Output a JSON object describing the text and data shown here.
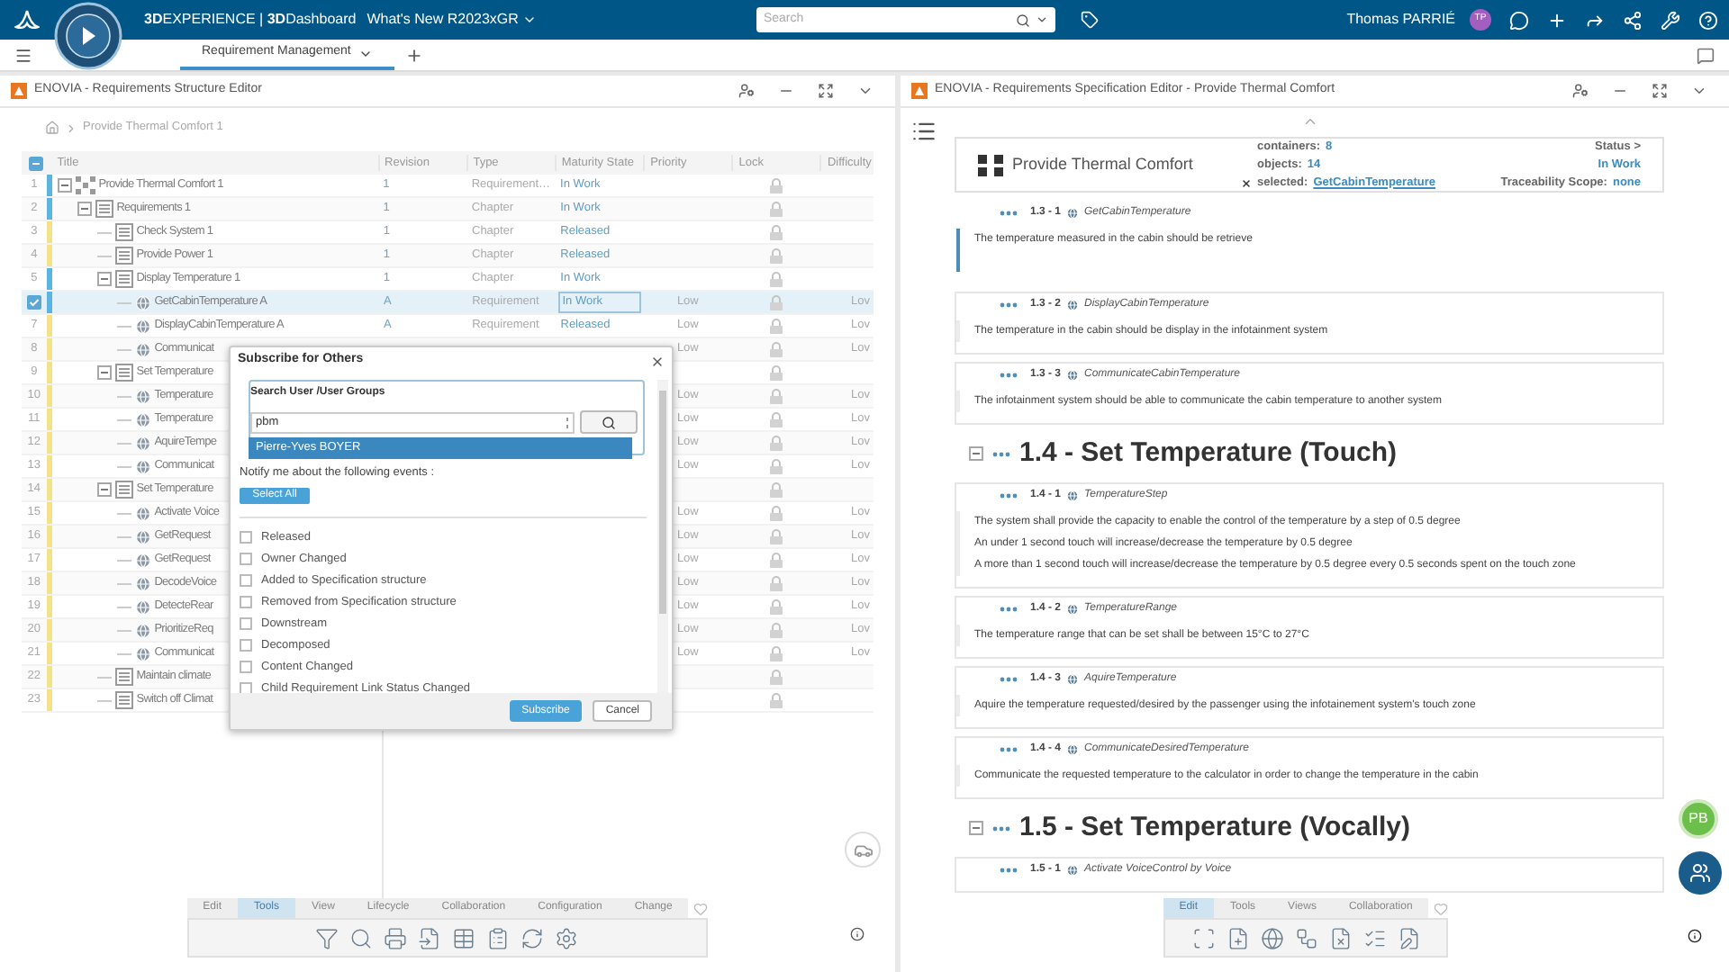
{
  "top_bar": {
    "brand": "**3D**EXPERIENCE | **3D**Dashboard",
    "dashboard": "What's New R2023xGR",
    "search": {
      "placeholder": "Search"
    },
    "user": {
      "name": "Thomas PARRIÉ",
      "initials": "TP"
    }
  },
  "tabs": [
    {
      "label": "Requirement Management",
      "selected": true
    }
  ],
  "structure_editor": {
    "title": "ENOVIA - Requirements Structure Editor",
    "breadcrumb": [
      "Provide Thermal Comfort 1"
    ],
    "select_all": {
      "checked": true,
      "indeterminate": true
    },
    "columns": [
      "Title",
      "Revision",
      "Type",
      "Maturity State",
      "Priority",
      "Lock",
      "Difficulty"
    ],
    "rows": [
      {
        "number": "1",
        "title": "Provide Thermal Comfort 1",
        "kind": "root",
        "revision": "1",
        "type": "Requirement…",
        "maturity": "In Work",
        "color": "#5bb5e0",
        "selected": false,
        "expanded": true,
        "children": [
          {
            "number": "2",
            "title": "Requirements 1",
            "kind": "chapter",
            "revision": "1",
            "type": "Chapter",
            "maturity": "In Work",
            "color": "#5bb5e0",
            "selected": false,
            "expanded": true,
            "children": [
              {
                "number": "3",
                "title": "Check System 1",
                "kind": "chapter",
                "revision": "1",
                "type": "Chapter",
                "maturity": "Released",
                "color": "#f3e28a",
                "selected": false
              },
              {
                "number": "4",
                "title": "Provide Power 1",
                "kind": "chapter",
                "revision": "1",
                "type": "Chapter",
                "maturity": "Released",
                "color": "#f3e28a",
                "selected": false
              },
              {
                "number": "5",
                "title": "Display Temperature 1",
                "kind": "chapter",
                "revision": "1",
                "type": "Chapter",
                "maturity": "In Work",
                "color": "#5bb5e0",
                "selected": false,
                "expanded": true,
                "children": [
                  {
                    "title": "GetCabinTemperature A",
                    "kind": "requirement",
                    "revision": "A",
                    "type": "Requirement",
                    "maturity": "In Work",
                    "priority": "Low",
                    "difficulty": "Lov",
                    "color": "#5bb5e0",
                    "selected": true
                  },
                  {
                    "number": "7",
                    "title": "DisplayCabinTemperature A",
                    "kind": "requirement",
                    "revision": "A",
                    "type": "Requirement",
                    "maturity": "Released",
                    "priority": "Low",
                    "difficulty": "Lov",
                    "color": "#f3e28a",
                    "selected": false
                  },
                  {
                    "number": "8",
                    "title": "Communicat",
                    "kind": "requirement",
                    "priority": "Low",
                    "difficulty": "Lov",
                    "color": "#f3e28a",
                    "selected": false
                  }
                ]
              },
              {
                "number": "9",
                "title": "Set Temperature",
                "kind": "chapter",
                "color": "#f3e28a",
                "selected": false,
                "expanded": true,
                "children": [
                  {
                    "number": "10",
                    "title": "Temperature",
                    "kind": "requirement",
                    "priority": "Low",
                    "difficulty": "Lov",
                    "color": "#f3e28a",
                    "selected": false
                  },
                  {
                    "number": "11",
                    "title": "Temperature",
                    "kind": "requirement",
                    "priority": "Low",
                    "difficulty": "Lov",
                    "color": "#f3e28a",
                    "selected": false
                  },
                  {
                    "number": "12",
                    "title": "AquireTempe",
                    "kind": "requirement",
                    "priority": "Low",
                    "difficulty": "Lov",
                    "color": "#f3e28a",
                    "selected": false
                  },
                  {
                    "number": "13",
                    "title": "Communicat",
                    "kind": "requirement",
                    "priority": "Low",
                    "difficulty": "Lov",
                    "color": "#f3e28a",
                    "selected": false
                  }
                ]
              },
              {
                "number": "14",
                "title": "Set Temperature",
                "kind": "chapter",
                "color": "#f3e28a",
                "selected": false,
                "expanded": true,
                "children": [
                  {
                    "number": "15",
                    "title": "Activate Voice",
                    "kind": "requirement",
                    "priority": "Low",
                    "difficulty": "Lov",
                    "color": "#f3e28a",
                    "selected": false
                  },
                  {
                    "number": "16",
                    "title": "GetRequest",
                    "kind": "requirement",
                    "priority": "Low",
                    "difficulty": "Lov",
                    "color": "#f3e28a",
                    "selected": false
                  },
                  {
                    "number": "17",
                    "title": "GetRequest",
                    "kind": "requirement",
                    "priority": "Low",
                    "difficulty": "Lov",
                    "color": "#f3e28a",
                    "selected": false
                  },
                  {
                    "number": "18",
                    "title": "DecodeVoice",
                    "kind": "requirement",
                    "priority": "Low",
                    "difficulty": "Lov",
                    "color": "#f3e28a",
                    "selected": false
                  },
                  {
                    "number": "19",
                    "title": "DetecteRear",
                    "kind": "requirement",
                    "priority": "Low",
                    "difficulty": "Lov",
                    "color": "#f3e28a",
                    "selected": false
                  },
                  {
                    "number": "20",
                    "title": "PrioritizeReq",
                    "kind": "requirement",
                    "priority": "Low",
                    "difficulty": "Lov",
                    "color": "#f3e28a",
                    "selected": false
                  },
                  {
                    "number": "21",
                    "title": "Communicat",
                    "kind": "requirement",
                    "priority": "Low",
                    "difficulty": "Lov",
                    "color": "#f3e28a",
                    "selected": false
                  }
                ]
              },
              {
                "number": "22",
                "title": "Maintain climate",
                "kind": "chapter",
                "color": "#f3e28a",
                "selected": false
              },
              {
                "number": "23",
                "title": "Switch off Climat",
                "kind": "chapter",
                "color": "#f3e28a",
                "selected": false
              }
            ]
          }
        ]
      }
    ],
    "toolbar": {
      "tabs": [
        {
          "label": "Edit",
          "selected": false
        },
        {
          "label": "Tools",
          "selected": true
        },
        {
          "label": "View",
          "selected": false
        },
        {
          "label": "Lifecycle",
          "selected": false
        },
        {
          "label": "Collaboration",
          "selected": false
        },
        {
          "label": "Configuration",
          "selected": false
        },
        {
          "label": "Change",
          "selected": false
        }
      ]
    }
  },
  "dialog": {
    "title": "Subscribe for Others",
    "search_label": "Search User /User Groups",
    "search": {
      "value": "pbm"
    },
    "suggestions": [
      {
        "label": "Pierre-Yves BOYER",
        "selected": true
      }
    ],
    "notify_label": "Notify me about the following events :",
    "select_all": "Select All",
    "events": [
      {
        "label": "Released",
        "checked": false
      },
      {
        "label": "Owner Changed",
        "checked": false
      },
      {
        "label": "Added to Specification structure",
        "checked": false
      },
      {
        "label": "Removed from Specification structure",
        "checked": false
      },
      {
        "label": "Downstream",
        "checked": false
      },
      {
        "label": "Decomposed",
        "checked": false
      },
      {
        "label": "Content Changed",
        "checked": false
      },
      {
        "label": "Child Requirement Link Status Changed",
        "checked": false
      }
    ],
    "buttons": [
      {
        "label": "Subscribe",
        "kind": "primary"
      },
      {
        "label": "Cancel",
        "kind": "secondary"
      }
    ]
  },
  "spec_editor": {
    "title": "ENOVIA - Requirements Specification Editor - Provide Thermal Comfort",
    "summary": {
      "name": "Provide Thermal Comfort",
      "containers_label": "containers:",
      "containers": "8",
      "objects_label": "objects:",
      "objects": "14",
      "selected_label": "selected:",
      "selected": "GetCabinTemperature",
      "status_label": "Status >",
      "status": "In Work",
      "scope_label": "Traceability Scope:",
      "scope": "none"
    },
    "items": [
      {
        "kind": "requirement",
        "number": "1.3 - 1",
        "name": "GetCabinTemperature",
        "lines": [
          "The temperature measured in the cabin should be retrieve"
        ],
        "selected": true
      },
      {
        "kind": "requirement",
        "number": "1.3 - 2",
        "name": "DisplayCabinTemperature",
        "lines": [
          "The temperature in the cabin should be display in the infotainment system"
        ],
        "selected": false
      },
      {
        "kind": "requirement",
        "number": "1.3 - 3",
        "name": "CommunicateCabinTemperature",
        "lines": [
          "The infotainment system should be able to communicate the cabin temperature to another system"
        ],
        "selected": false
      },
      {
        "kind": "heading",
        "title": "1.4 - Set Temperature (Touch)",
        "expanded": true
      },
      {
        "kind": "requirement",
        "number": "1.4 - 1",
        "name": "TemperatureStep",
        "lines": [
          "The system shall provide the capacity to enable the control of the temperature by a step of 0.5 degree",
          "An under 1 second touch will increase/decrease the temperature by 0.5 degree",
          "A more than 1 second touch will increase/decrease the temperature by 0.5 degree every 0.5 seconds spent on the touch zone"
        ],
        "selected": false
      },
      {
        "kind": "requirement",
        "number": "1.4 - 2",
        "name": "TemperatureRange",
        "lines": [
          "The temperature range that can be set shall be between 15°C to 27°C"
        ],
        "selected": false
      },
      {
        "kind": "requirement",
        "number": "1.4 - 3",
        "name": "AquireTemperature",
        "lines": [
          "Aquire the temperature requested/desired by the passenger using the infotainement system's touch zone"
        ],
        "selected": false
      },
      {
        "kind": "requirement",
        "number": "1.4 - 4",
        "name": "CommunicateDesiredTemperature",
        "lines": [
          "Communicate the requested temperature to the calculator in order to change the temperature in the cabin"
        ],
        "selected": false
      },
      {
        "kind": "heading",
        "title": "1.5 - Set Temperature (Vocally)",
        "expanded": true
      },
      {
        "kind": "requirement",
        "number": "1.5 - 1",
        "name": "Activate VoiceControl by Voice",
        "selected": false
      }
    ],
    "toolbar": {
      "tabs": [
        {
          "label": "Edit",
          "selected": true
        },
        {
          "label": "Tools",
          "selected": false
        },
        {
          "label": "Views",
          "selected": false
        },
        {
          "label": "Collaboration",
          "selected": false
        }
      ]
    }
  },
  "floating": {
    "initials": "PB"
  }
}
